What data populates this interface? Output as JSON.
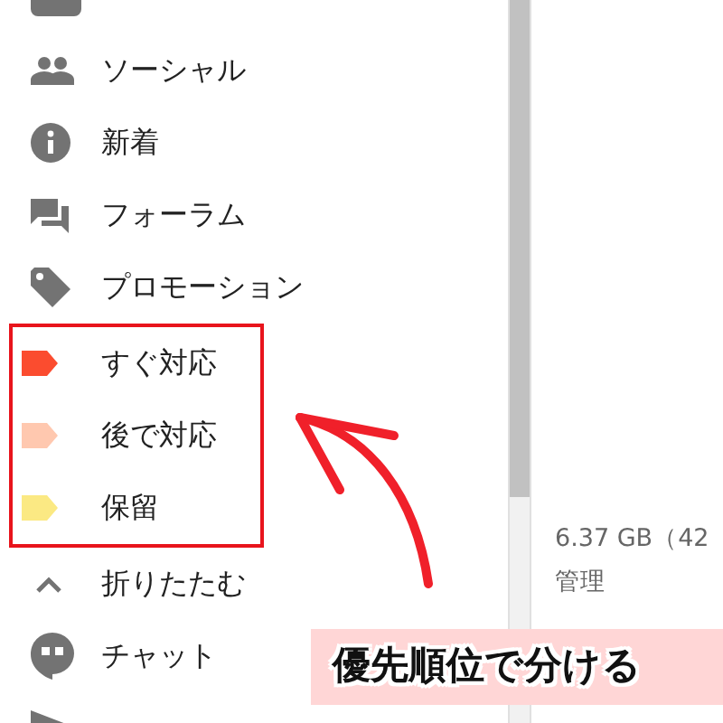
{
  "sidebar": {
    "sections": [
      {
        "highlighted": false,
        "items": [
          {
            "kind": "category"
          },
          {
            "kind": "social",
            "label": "ソーシャル"
          },
          {
            "kind": "updates",
            "label": "新着"
          },
          {
            "kind": "forums",
            "label": "フォーラム"
          },
          {
            "kind": "promotions",
            "label": "プロモーション"
          }
        ]
      },
      {
        "highlighted": true,
        "items": [
          {
            "kind": "label",
            "label": "すぐ対応",
            "color": "#fb4c2f"
          },
          {
            "kind": "label",
            "label": "後で対応",
            "color": "#ffc8af"
          },
          {
            "kind": "label",
            "label": "保留",
            "color": "#fbe983"
          }
        ]
      },
      {
        "highlighted": false,
        "items": [
          {
            "kind": "collapse",
            "label": "折りたたむ"
          },
          {
            "kind": "chat",
            "label": "チャット"
          },
          {
            "kind": "scheduled"
          }
        ]
      }
    ]
  },
  "storage": {
    "usage": "6.37 GB（42",
    "manage_link": "管理"
  },
  "annotation": {
    "callout": "優先順位で分ける"
  }
}
